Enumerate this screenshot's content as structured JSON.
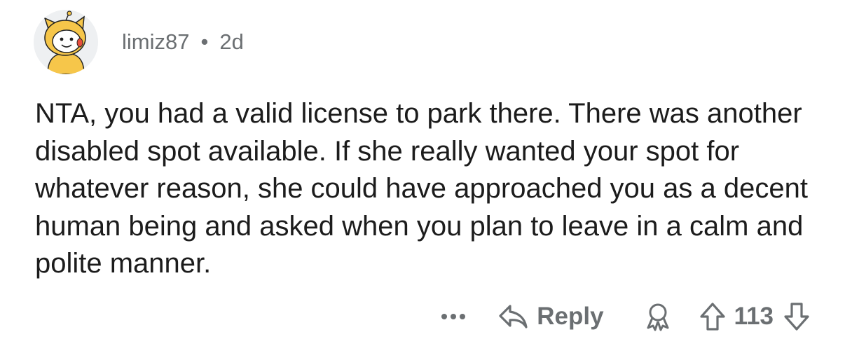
{
  "comment": {
    "author": "limiz87",
    "separator": "•",
    "age": "2d",
    "avatar_icon": "snoo-dog-costume-avatar",
    "body": "NTA, you had a valid license to park there. There was another disabled spot available. If she really wanted your spot for whatever reason, she could have approached you as a decent human being and asked when you plan to leave in a calm and polite manner."
  },
  "actions": {
    "more_icon": "more-dots-icon",
    "reply_icon": "reply-arrow-icon",
    "reply_label": "Reply",
    "award_icon": "award-icon",
    "upvote_icon": "upvote-arrow-icon",
    "score": "113",
    "downvote_icon": "downvote-arrow-icon"
  },
  "colors": {
    "text": "#1c1c1c",
    "meta": "#6b6f72",
    "background": "#ffffff"
  }
}
